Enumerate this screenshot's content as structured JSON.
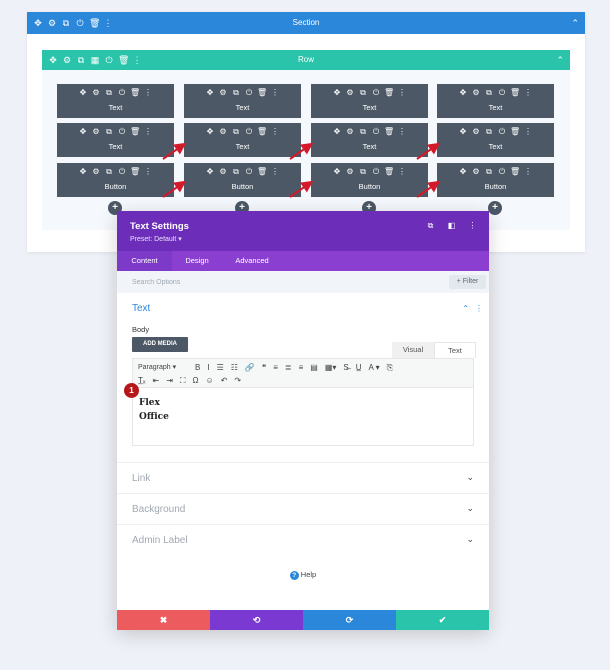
{
  "section": {
    "title": "Section",
    "icons": [
      "✥",
      "⚙",
      "⧉",
      "⏻",
      "🗑",
      "⋮"
    ],
    "chevron": "⌃",
    "color": "#2b87da"
  },
  "row": {
    "title": "Row",
    "icons": [
      "✥",
      "⚙",
      "⧉",
      "▦",
      "⏻",
      "🗑",
      "⋮"
    ],
    "chevron": "⌃",
    "color": "#29c4a9"
  },
  "modules": {
    "icons": [
      "✥",
      "⚙",
      "⧉",
      "⏻",
      "🗑",
      "⋮"
    ],
    "grid": [
      [
        "Text",
        "Text",
        "Text",
        "Text"
      ],
      [
        "Text",
        "Text",
        "Text",
        "Text"
      ],
      [
        "Button",
        "Button",
        "Button",
        "Button"
      ]
    ],
    "add": "+"
  },
  "arrow_color": "#d3192a",
  "modal": {
    "title": "Text Settings",
    "preset": "Preset: Default ▾",
    "header_icons": [
      "⧉",
      "◧",
      "⋮"
    ],
    "tabs": [
      {
        "label": "Content",
        "active": true
      },
      {
        "label": "Design",
        "active": false
      },
      {
        "label": "Advanced",
        "active": false
      }
    ],
    "search_placeholder": "Search Options",
    "filter_label": "+ Filter",
    "text_section": {
      "title": "Text",
      "icons": [
        "⌃",
        "⋮"
      ],
      "body_label": "Body",
      "add_media": "ADD MEDIA",
      "editor_tabs": [
        "Visual",
        "Text"
      ],
      "toolbar_row1": [
        "Paragraph ▾",
        "B",
        "I",
        "☰",
        "☷",
        "🔗",
        "❝",
        "≡",
        "≣",
        "≡",
        "▤",
        "▦▾",
        "S̶",
        "U̲",
        "A ▾",
        "⎘"
      ],
      "toolbar_row2": [
        "T̲ₓ",
        "⇤",
        "⇥",
        "⛶",
        "Ω",
        "☺",
        "↶",
        "↷"
      ],
      "content_lines": [
        "Flex",
        "Office"
      ],
      "marker": "1"
    },
    "collapsed_sections": [
      "Link",
      "Background",
      "Admin Label"
    ],
    "help": "Help",
    "footer": {
      "cancel": "✖",
      "undo": "⟲",
      "redo": "⟳",
      "save": "✔",
      "colors": [
        "#ec5c5e",
        "#7a3ad1",
        "#2b87da",
        "#29c4a9"
      ]
    }
  }
}
